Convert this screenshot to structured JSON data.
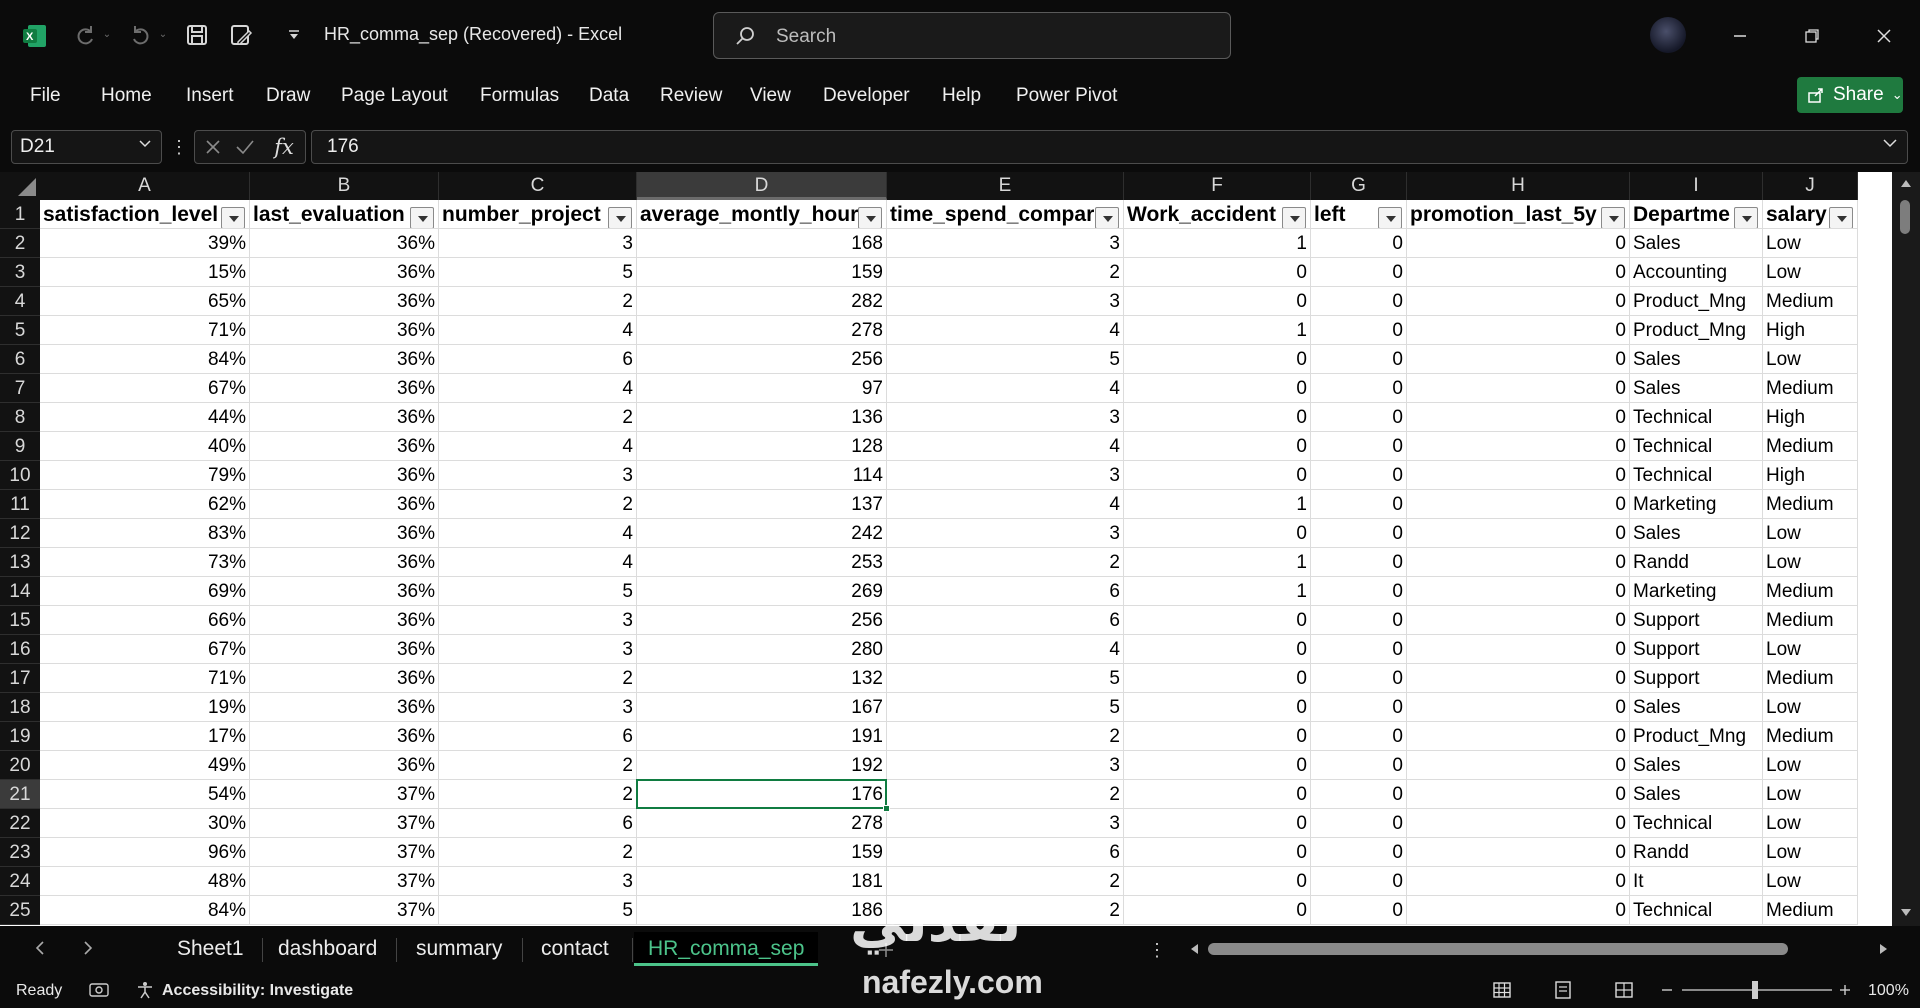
{
  "titlebar": {
    "title": "HR_comma_sep (Recovered)  -  Excel",
    "search_placeholder": "Search"
  },
  "menu": {
    "items": [
      "File",
      "Home",
      "Insert",
      "Draw",
      "Page Layout",
      "Formulas",
      "Data",
      "Review",
      "View",
      "Developer",
      "Help",
      "Power Pivot"
    ],
    "share_label": "Share"
  },
  "formula_bar": {
    "name_box": "D21",
    "fx": "fx",
    "value": "176"
  },
  "sheet": {
    "columns": [
      "A",
      "B",
      "C",
      "D",
      "E",
      "F",
      "G",
      "H",
      "I",
      "J"
    ],
    "headers": [
      "satisfaction_level",
      "last_evaluation",
      "number_project",
      "average_montly_hour",
      "time_spend_compar",
      "Work_accident",
      "left",
      "promotion_last_5y",
      "Departme",
      "salary"
    ],
    "row_numbers": [
      "1",
      "2",
      "3",
      "4",
      "5",
      "6",
      "7",
      "8",
      "9",
      "10",
      "11",
      "12",
      "13",
      "14",
      "15",
      "16",
      "17",
      "18",
      "19",
      "20",
      "21",
      "22",
      "23",
      "24",
      "25"
    ],
    "rows": [
      [
        "39%",
        "36%",
        "3",
        "168",
        "3",
        "1",
        "0",
        "0",
        "Sales",
        "Low"
      ],
      [
        "15%",
        "36%",
        "5",
        "159",
        "2",
        "0",
        "0",
        "0",
        "Accounting",
        "Low"
      ],
      [
        "65%",
        "36%",
        "2",
        "282",
        "3",
        "0",
        "0",
        "0",
        "Product_Mng",
        "Medium"
      ],
      [
        "71%",
        "36%",
        "4",
        "278",
        "4",
        "1",
        "0",
        "0",
        "Product_Mng",
        "High"
      ],
      [
        "84%",
        "36%",
        "6",
        "256",
        "5",
        "0",
        "0",
        "0",
        "Sales",
        "Low"
      ],
      [
        "67%",
        "36%",
        "4",
        "97",
        "4",
        "0",
        "0",
        "0",
        "Sales",
        "Medium"
      ],
      [
        "44%",
        "36%",
        "2",
        "136",
        "3",
        "0",
        "0",
        "0",
        "Technical",
        "High"
      ],
      [
        "40%",
        "36%",
        "4",
        "128",
        "4",
        "0",
        "0",
        "0",
        "Technical",
        "Medium"
      ],
      [
        "79%",
        "36%",
        "3",
        "114",
        "3",
        "0",
        "0",
        "0",
        "Technical",
        "High"
      ],
      [
        "62%",
        "36%",
        "2",
        "137",
        "4",
        "1",
        "0",
        "0",
        "Marketing",
        "Medium"
      ],
      [
        "83%",
        "36%",
        "4",
        "242",
        "3",
        "0",
        "0",
        "0",
        "Sales",
        "Low"
      ],
      [
        "73%",
        "36%",
        "4",
        "253",
        "2",
        "1",
        "0",
        "0",
        "Randd",
        "Low"
      ],
      [
        "69%",
        "36%",
        "5",
        "269",
        "6",
        "1",
        "0",
        "0",
        "Marketing",
        "Medium"
      ],
      [
        "66%",
        "36%",
        "3",
        "256",
        "6",
        "0",
        "0",
        "0",
        "Support",
        "Medium"
      ],
      [
        "67%",
        "36%",
        "3",
        "280",
        "4",
        "0",
        "0",
        "0",
        "Support",
        "Low"
      ],
      [
        "71%",
        "36%",
        "2",
        "132",
        "5",
        "0",
        "0",
        "0",
        "Support",
        "Medium"
      ],
      [
        "19%",
        "36%",
        "3",
        "167",
        "5",
        "0",
        "0",
        "0",
        "Sales",
        "Low"
      ],
      [
        "17%",
        "36%",
        "6",
        "191",
        "2",
        "0",
        "0",
        "0",
        "Product_Mng",
        "Medium"
      ],
      [
        "49%",
        "36%",
        "2",
        "192",
        "3",
        "0",
        "0",
        "0",
        "Sales",
        "Low"
      ],
      [
        "54%",
        "37%",
        "2",
        "176",
        "2",
        "0",
        "0",
        "0",
        "Sales",
        "Low"
      ],
      [
        "30%",
        "37%",
        "6",
        "278",
        "3",
        "0",
        "0",
        "0",
        "Technical",
        "Low"
      ],
      [
        "96%",
        "37%",
        "2",
        "159",
        "6",
        "0",
        "0",
        "0",
        "Randd",
        "Low"
      ],
      [
        "48%",
        "37%",
        "3",
        "181",
        "2",
        "0",
        "0",
        "0",
        "It",
        "Low"
      ],
      [
        "84%",
        "37%",
        "5",
        "186",
        "2",
        "0",
        "0",
        "0",
        "Technical",
        "Medium"
      ]
    ],
    "active_cell": "D21"
  },
  "tabs": {
    "items": [
      "Sheet1",
      "dashboard",
      "summary",
      "contact",
      "HR_comma_sep"
    ],
    "active": "HR_comma_sep"
  },
  "status": {
    "ready": "Ready",
    "accessibility": "Accessibility: Investigate",
    "zoom": "100%"
  },
  "watermark": {
    "arabic": "نفذلي",
    "latin": "nafezly.com"
  },
  "colors": {
    "excel_green": "#107c41",
    "active_tab_green": "#4cc38a",
    "share_green": "#1f7a3f"
  }
}
